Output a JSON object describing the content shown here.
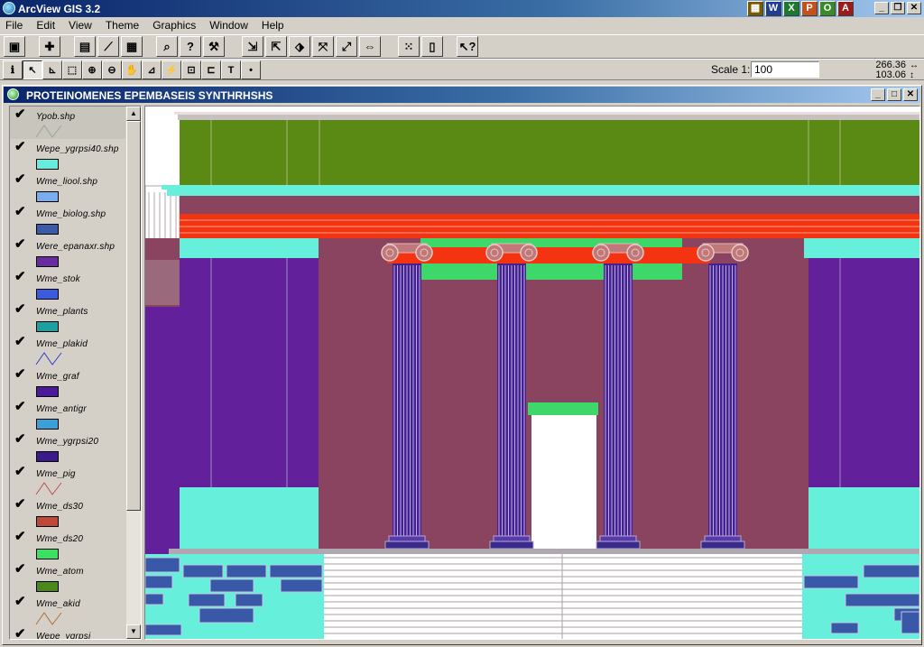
{
  "app": {
    "title": "ArcView GIS 3.2",
    "taskbar_icons": [
      {
        "icon": "ms-office-icon",
        "glyph": "▦",
        "color": "#7a5a00"
      },
      {
        "icon": "word-icon",
        "glyph": "W",
        "color": "#1f3c96"
      },
      {
        "icon": "excel-icon",
        "glyph": "X",
        "color": "#1d7a2c"
      },
      {
        "icon": "powerpoint-icon",
        "glyph": "P",
        "color": "#c4501c"
      },
      {
        "icon": "outlook-icon",
        "glyph": "O",
        "color": "#3a8a2a"
      },
      {
        "icon": "access-icon",
        "glyph": "A",
        "color": "#9a1c1c"
      }
    ]
  },
  "menu": [
    "File",
    "Edit",
    "View",
    "Theme",
    "Graphics",
    "Window",
    "Help"
  ],
  "toolbar": {
    "scale_label": "Scale 1:",
    "scale_value": "100",
    "coord_x": "266.36",
    "coord_y": "103.06"
  },
  "view": {
    "title": "PROTEINOMENES EPEMBASEIS SYNTHRHSHS"
  },
  "toc": {
    "entries": [
      {
        "name": "Ypob.shp",
        "symbol": "line",
        "color": "#a0a0a0",
        "active": true
      },
      {
        "name": "Wepe_ygrpsi40.shp",
        "symbol": "fill",
        "color": "#66eedd"
      },
      {
        "name": "Wme_liool.shp",
        "symbol": "fill",
        "color": "#7aacf0"
      },
      {
        "name": "Wme_biolog.shp",
        "symbol": "fill",
        "color": "#3a5aa8"
      },
      {
        "name": "Were_epanaxr.shp",
        "symbol": "fill",
        "color": "#6a2aa0"
      },
      {
        "name": "Wme_stok",
        "symbol": "fill",
        "color": "#3a5ae0"
      },
      {
        "name": "Wme_plants",
        "symbol": "fill",
        "color": "#1aa0a0"
      },
      {
        "name": "Wme_plakid",
        "symbol": "line",
        "color": "#3a3ad0"
      },
      {
        "name": "Wme_graf",
        "symbol": "fill",
        "color": "#4a1a9a"
      },
      {
        "name": "Wme_antigr",
        "symbol": "fill",
        "color": "#3aa0d8"
      },
      {
        "name": "Wme_ygrpsi20",
        "symbol": "fill",
        "color": "#3a1a8a"
      },
      {
        "name": "Wme_pig",
        "symbol": "line",
        "color": "#c05050"
      },
      {
        "name": "Wme_ds30",
        "symbol": "fill",
        "color": "#c04838"
      },
      {
        "name": "Wme_ds20",
        "symbol": "fill",
        "color": "#3ae060"
      },
      {
        "name": "Wme_atom",
        "symbol": "fill",
        "color": "#4a8a1a"
      },
      {
        "name": "Wme_akid",
        "symbol": "line",
        "color": "#b07030"
      },
      {
        "name": "Wepe_ygrpsi",
        "symbol": "fill",
        "color": "#808080"
      }
    ]
  },
  "colors": {
    "entablature": "#5a8a14",
    "stripe_cyan": "#66f0dc",
    "wall": "#8a4460",
    "red": "#f43410",
    "green_band": "#3ed86a",
    "purple": "#62209a",
    "column": "#46208e",
    "stone": "#3a58a8",
    "gray_line": "#c0b8b8"
  }
}
